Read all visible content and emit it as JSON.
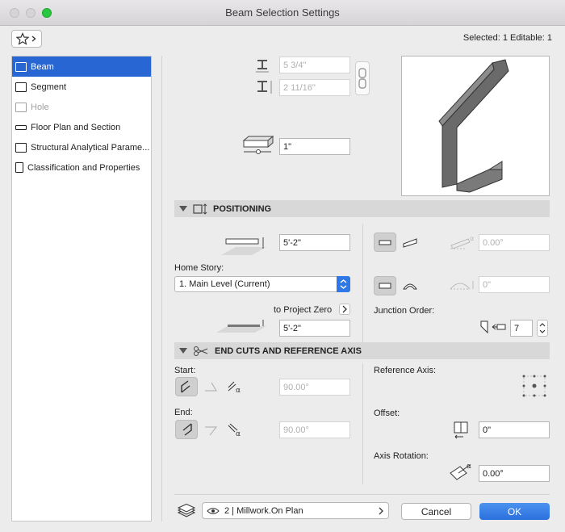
{
  "window": {
    "title": "Beam Selection Settings"
  },
  "toolbar": {
    "selected_info": "Selected: 1 Editable: 1"
  },
  "sidebar": {
    "items": [
      {
        "label": "Beam",
        "state": "active"
      },
      {
        "label": "Segment",
        "state": "normal"
      },
      {
        "label": "Hole",
        "state": "disabled"
      },
      {
        "label": "Floor Plan and Section",
        "state": "normal"
      },
      {
        "label": "Structural Analytical Parame...",
        "state": "normal"
      },
      {
        "label": "Classification and Properties",
        "state": "normal"
      }
    ]
  },
  "beam": {
    "width": "5 3/4\"",
    "height": "2 11/16\"",
    "offset": "1\""
  },
  "positioning": {
    "header": "POSITIONING",
    "elevation": "5'-2\"",
    "home_story_label": "Home Story:",
    "home_story_value": "1. Main Level (Current)",
    "to_project_zero_label": "to Project Zero",
    "project_zero_value": "5'-2\"",
    "slant_angle": "0.00°",
    "curve_value": "0\"",
    "junction_order_label": "Junction Order:",
    "junction_order_value": "7"
  },
  "end_cuts": {
    "header": "END CUTS AND REFERENCE AXIS",
    "start_label": "Start:",
    "start_angle": "90.00°",
    "end_label": "End:",
    "end_angle": "90.00°",
    "reference_axis_label": "Reference Axis:",
    "offset_label": "Offset:",
    "offset_value": "0\"",
    "axis_rotation_label": "Axis Rotation:",
    "axis_rotation_value": "0.00°"
  },
  "footer": {
    "layer_value": "2 | Millwork.On Plan",
    "cancel_label": "Cancel",
    "ok_label": "OK"
  },
  "colors": {
    "accent": "#2867d3",
    "close": "#ff5f57",
    "minimize": "#febc2e",
    "zoom": "#28c840"
  }
}
